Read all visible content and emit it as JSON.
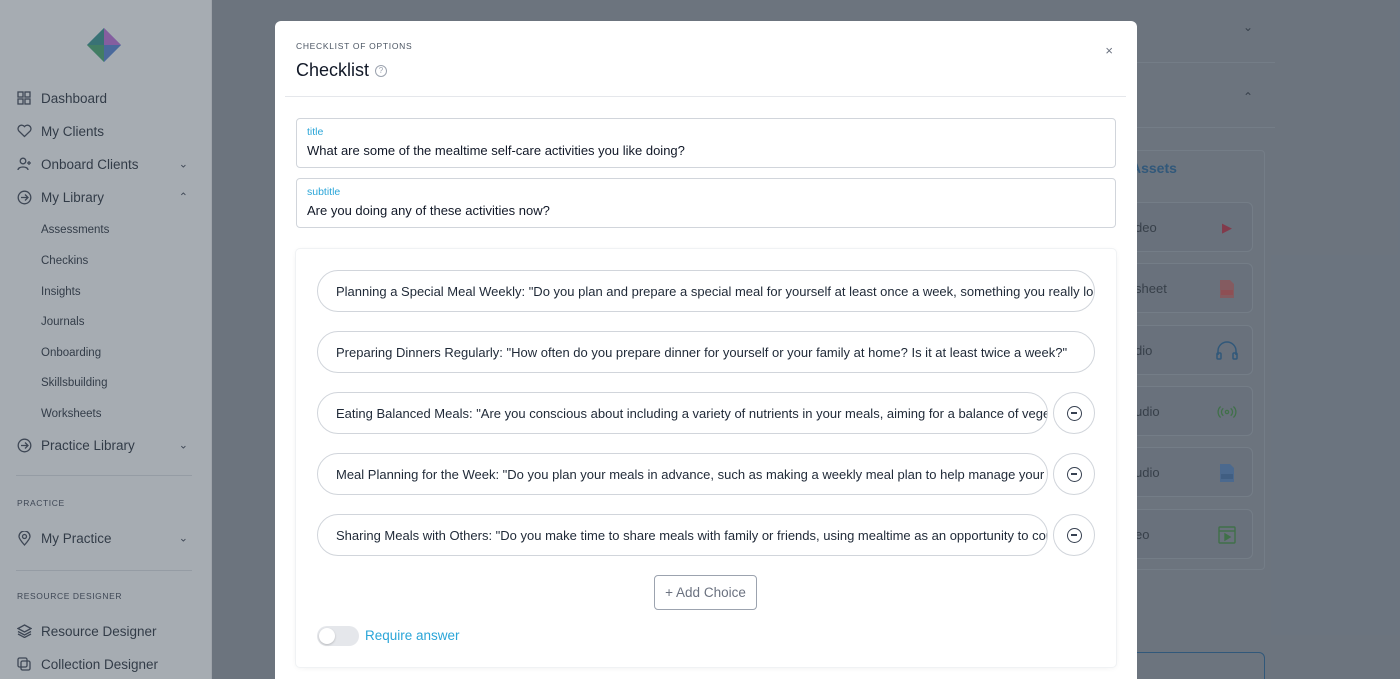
{
  "sidebar": {
    "nav": [
      {
        "label": "Dashboard"
      },
      {
        "label": "My Clients"
      },
      {
        "label": "Onboard Clients"
      },
      {
        "label": "My Library"
      }
    ],
    "library_items": [
      "Assessments",
      "Checkins",
      "Insights",
      "Journals",
      "Onboarding",
      "Skillsbuilding",
      "Worksheets"
    ],
    "practice_library": "Practice Library",
    "practice_section": "PRACTICE",
    "my_practice": "My Practice",
    "resource_section": "RESOURCE DESIGNER",
    "resource_designer": "Resource Designer",
    "collection_designer": "Collection Designer"
  },
  "background": {
    "assets_title": "Assets",
    "asset_cards": [
      "deo",
      "sheet",
      "dio",
      "udio",
      "udio",
      "eo"
    ]
  },
  "modal": {
    "kicker": "CHECKLIST OF OPTIONS",
    "title": "Checklist",
    "close_glyph": "×",
    "help_glyph": "?",
    "title_field": {
      "label": "title",
      "value": "What are some of the mealtime self-care activities you like doing?"
    },
    "subtitle_field": {
      "label": "subtitle",
      "value": "Are you doing any of these activities now?"
    },
    "choices": [
      "Planning a Special Meal Weekly: \"Do you plan and prepare a special meal for yourself at least once a week, something you really look forward to?\"",
      "Preparing Dinners Regularly: \"How often do you prepare dinner for yourself or your family at home? Is it at least twice a week?\"",
      "Eating Balanced Meals: \"Are you conscious about including a variety of nutrients in your meals, aiming for a balance of vegetables, proteins and grains?\"",
      "Meal Planning for the Week: \"Do you plan your meals in advance, such as making a weekly meal plan to help manage your diet?\"",
      "Sharing Meals with Others: \"Do you make time to share meals with family or friends, using mealtime as an opportunity to connect?\""
    ],
    "add_choice": "+ Add Choice",
    "require_answer": "Require answer"
  }
}
